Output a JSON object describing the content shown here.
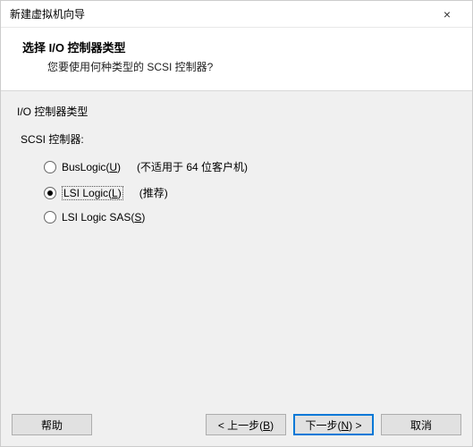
{
  "window": {
    "title": "新建虚拟机向导",
    "close": "×"
  },
  "header": {
    "heading": "选择 I/O 控制器类型",
    "subheading": "您要使用何种类型的 SCSI 控制器?"
  },
  "content": {
    "group_label": "I/O 控制器类型",
    "scsi_label": "SCSI 控制器:",
    "options": [
      {
        "label_pre": "BusLogic(",
        "hotkey": "U",
        "label_post": ")",
        "hint": "(不适用于 64 位客户机)",
        "selected": false,
        "focus": false
      },
      {
        "label_pre": "LSI Logic(",
        "hotkey": "L",
        "label_post": ")",
        "hint": "(推荐)",
        "selected": true,
        "focus": true
      },
      {
        "label_pre": "LSI Logic SAS(",
        "hotkey": "S",
        "label_post": ")",
        "hint": "",
        "selected": false,
        "focus": false
      }
    ]
  },
  "footer": {
    "help": "帮助",
    "back_pre": "< 上一步(",
    "back_hotkey": "B",
    "back_post": ")",
    "next_pre": "下一步(",
    "next_hotkey": "N",
    "next_post": ") >",
    "cancel": "取消"
  }
}
